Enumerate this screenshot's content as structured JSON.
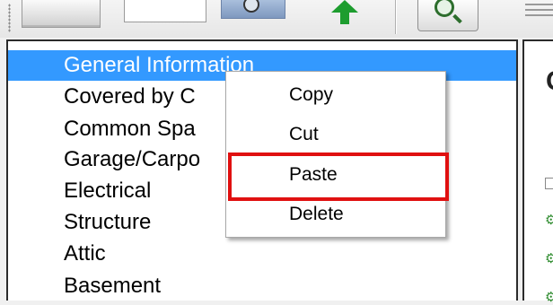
{
  "toolbar": {
    "buttons": [
      {
        "name": "folder-icon"
      },
      {
        "name": "page-icon"
      },
      {
        "name": "view-icon"
      },
      {
        "name": "up-arrow-icon"
      },
      {
        "name": "search-icon"
      },
      {
        "name": "lines-icon"
      }
    ]
  },
  "tree": {
    "items": [
      {
        "label": "General Information",
        "selected": true
      },
      {
        "label": "Covered by C"
      },
      {
        "label": "Common Spa"
      },
      {
        "label": "Garage/Carpo"
      },
      {
        "label": "Electrical"
      },
      {
        "label": "Structure"
      },
      {
        "label": "Attic"
      },
      {
        "label": "Basement"
      }
    ]
  },
  "context_menu": {
    "items": [
      {
        "label": "Copy"
      },
      {
        "label": "Cut"
      },
      {
        "label": "Paste",
        "highlighted": true
      },
      {
        "label": "Delete"
      }
    ],
    "highlight_color": "#e01010"
  },
  "right_panel": {
    "heading_glyph": "C"
  },
  "colors": {
    "selection": "#3399ff",
    "accent_green": "#1e9d2f"
  }
}
